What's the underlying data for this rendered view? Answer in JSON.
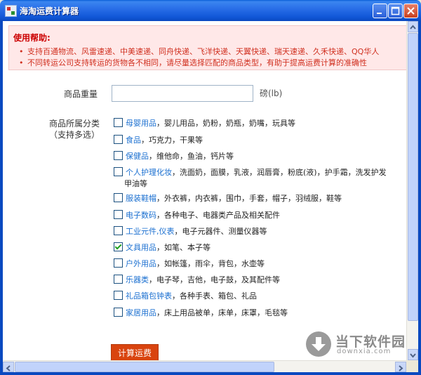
{
  "window": {
    "title": "海淘运费计算器"
  },
  "help": {
    "title": "使用帮助:",
    "bullet": "•",
    "lines": [
      "支持百通物流、风雷速递、中美速递、同舟快递、飞洋快递、天翼快递、瑞天速递、久禾快递、QQ华人",
      "不同转运公司支持转运的货物各不相同，请尽量选择匹配的商品类型，有助于提高运费计算的准确性"
    ]
  },
  "form": {
    "weight_label": "商品重量",
    "weight_value": "",
    "weight_unit": "磅(lb)",
    "category_label_1": "商品所属分类",
    "category_label_2": "（支持多选）",
    "categories": [
      {
        "name": "母婴用品",
        "desc": "，婴儿用品，奶粉，奶瓶，奶嘴，玩具等",
        "cont": "",
        "checked": false
      },
      {
        "name": "食品",
        "desc": "，巧克力，干果等",
        "cont": "",
        "checked": false
      },
      {
        "name": "保健品",
        "desc": "，维他命，鱼油，钙片等",
        "cont": "",
        "checked": false
      },
      {
        "name": "个人护理化妆",
        "desc": "，洗面奶，面膜，乳液，润唇膏，粉底(液)，护手霜，洗发护发",
        "cont": "甲油等",
        "checked": false
      },
      {
        "name": "服装鞋帽",
        "desc": "，外衣裤，内衣裤，围巾，手套，帽子，羽绒服，鞋等",
        "cont": "",
        "checked": false
      },
      {
        "name": "电子数码",
        "desc": "，各种电子、电器类产品及相关配件",
        "cont": "",
        "checked": false
      },
      {
        "name": "工业元件,仪表",
        "desc": "，电子元器件、测量仪器等",
        "cont": "",
        "checked": false
      },
      {
        "name": "文具用品",
        "desc": "，如笔、本子等",
        "cont": "",
        "checked": true
      },
      {
        "name": "户外用品",
        "desc": "，如帐篷，雨伞，背包，水壶等",
        "cont": "",
        "checked": false
      },
      {
        "name": "乐器类",
        "desc": "，电子琴，吉他，电子鼓，及其配件等",
        "cont": "",
        "checked": false
      },
      {
        "name": "礼品箱包钟表",
        "desc": "，各种手表、箱包、礼品",
        "cont": "",
        "checked": false
      },
      {
        "name": "家居用品",
        "desc": "，床上用品被单，床单，床罩，毛毯等",
        "cont": "",
        "checked": false
      }
    ],
    "calc_button": "计算运费"
  },
  "watermark": {
    "text": "当下软件园",
    "sub": "downxia.com"
  },
  "colors": {
    "help_bg": "#ffe8e8",
    "help_text": "#d03020",
    "category_link": "#1a6fd0",
    "button_bg": "#d9440f"
  }
}
